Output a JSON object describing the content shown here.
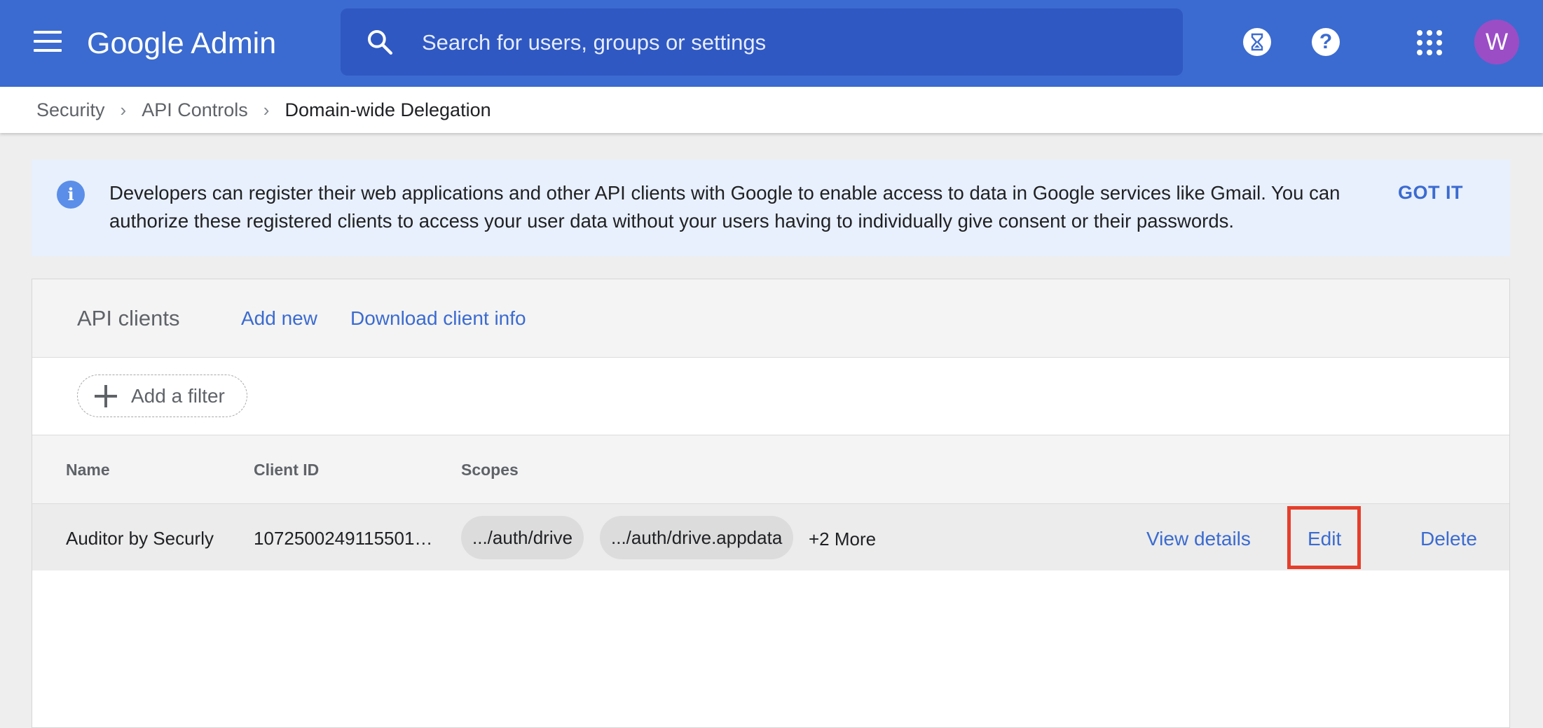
{
  "header": {
    "brand": "Google Admin",
    "search_placeholder": "Search for users, groups or settings",
    "avatar_initial": "W",
    "help_glyph": "?",
    "icons": [
      "menu-icon",
      "search-icon",
      "hourglass-icon",
      "help-icon",
      "apps-grid-icon"
    ]
  },
  "breadcrumb": {
    "items": [
      "Security",
      "API Controls",
      "Domain-wide Delegation"
    ],
    "separator": "›"
  },
  "banner": {
    "info_glyph": "i",
    "text": "Developers can register their web applications and other API clients with Google to enable access to data in Google services like Gmail. You can authorize these registered clients to access your user data without your users having to individually give consent or their passwords.",
    "action": "GOT IT"
  },
  "card": {
    "title": "API clients",
    "add_new": "Add new",
    "download": "Download client info",
    "filter_label": "Add a filter",
    "columns": [
      "Name",
      "Client ID",
      "Scopes"
    ],
    "rows": [
      {
        "name": "Auditor by Securly",
        "client_id": "1072500249115501…",
        "scopes": [
          ".../auth/drive",
          ".../auth/drive.appdata"
        ],
        "more": "+2 More",
        "actions": [
          "View details",
          "Edit",
          "Delete"
        ]
      }
    ]
  },
  "colors": {
    "app_bar": "#3b6bd0",
    "search_bg": "#2f58c2",
    "link": "#3b6bd0",
    "banner_bg": "#e8f0fd",
    "highlight": "#e53e2b",
    "avatar": "#9b4dc6"
  }
}
